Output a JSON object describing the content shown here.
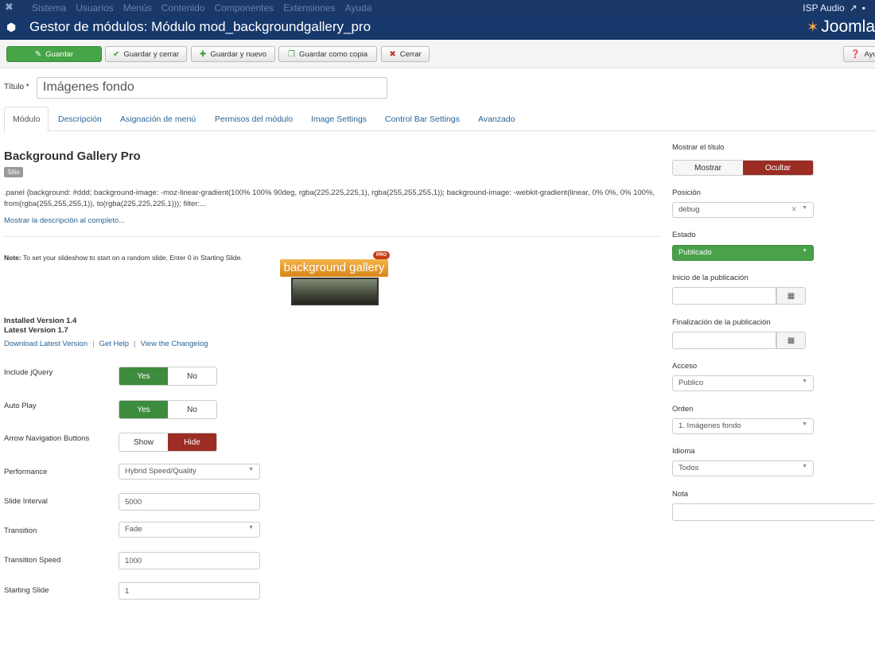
{
  "navbar": {
    "logo_icon": "joomla-icon",
    "menu": [
      "Sistema",
      "Usuarios",
      "Menús",
      "Contenido",
      "Componentes",
      "Extensiones",
      "Ayuda"
    ],
    "site_link": "ISP Audio"
  },
  "header": {
    "title": "Gestor de módulos: Módulo mod_backgroundgallery_pro",
    "brand": "Joomla"
  },
  "toolbar": {
    "save": "Guardar",
    "save_close": "Guardar y cerrar",
    "save_new": "Guardar y nuevo",
    "save_copy": "Guardar como copia",
    "close": "Cerrar",
    "help": "Ayu"
  },
  "form": {
    "title_label": "Título *",
    "title_value": "Imágenes fondo"
  },
  "tabs": [
    "Módulo",
    "Descripción",
    "Asignación de menú",
    "Permisos del módulo",
    "Image Settings",
    "Control Bar Settings",
    "Avanzado"
  ],
  "module": {
    "name": "Background Gallery Pro",
    "badge": "Sitio",
    "description": ".panel {background: #ddd; background-image: -moz-linear-gradient(100% 100% 90deg, rgba(225,225,225,1), rgba(255,255,255,1)); background-image: -webkit-gradient(linear, 0% 0%, 0% 100%, from(rgba(255,255,255,1)), to(rgba(225,225,225,1))); filter:...",
    "show_more": "Mostrar la descripción al completo...",
    "note_bold": "Note:",
    "note_text": " To set your slideshow to start on a random slide, Enter 0 in Starting Slide.",
    "logo_text": "background gallery",
    "logo_badge": "PRO",
    "installed": "Installed Version 1.4",
    "latest": "Latest Version 1.7",
    "link_download": "Download Latest Version",
    "link_help": "Get Help",
    "link_changelog": "View the Changelog",
    "separator": "|"
  },
  "settings": {
    "include_jquery": {
      "label": "Include jQuery",
      "on": "Yes",
      "off": "No"
    },
    "auto_play": {
      "label": "Auto Play",
      "on": "Yes",
      "off": "No"
    },
    "arrow_nav": {
      "label": "Arrow Navigation Buttons",
      "on": "Show",
      "off": "Hide"
    },
    "performance": {
      "label": "Performance",
      "value": "Hybrid Speed/Quality"
    },
    "slide_interval": {
      "label": "Slide Interval",
      "value": "5000"
    },
    "transition": {
      "label": "Transition",
      "value": "Fade"
    },
    "transition_speed": {
      "label": "Transition Speed",
      "value": "1000"
    },
    "starting_slide": {
      "label": "Starting Slide",
      "value": "1"
    }
  },
  "right": {
    "show_title_label": "Mostrar el título",
    "show_title_on": "Mostrar",
    "show_title_off": "Ocultar",
    "position_label": "Posición",
    "position_value": "debug",
    "status_label": "Estado",
    "status_value": "Publicado",
    "publish_start_label": "Inicio de la publicación",
    "publish_end_label": "Finalización de la publicación",
    "access_label": "Acceso",
    "access_value": "Publico",
    "order_label": "Orden",
    "order_value": "1. Imágenes fondo",
    "language_label": "Idioma",
    "language_value": "Todos",
    "note_label": "Nota"
  },
  "colors": {
    "navbar": "#1a3867",
    "header": "#17386b",
    "green": "#3d8b3d",
    "red": "#9b2d24",
    "link": "#2a6496"
  }
}
